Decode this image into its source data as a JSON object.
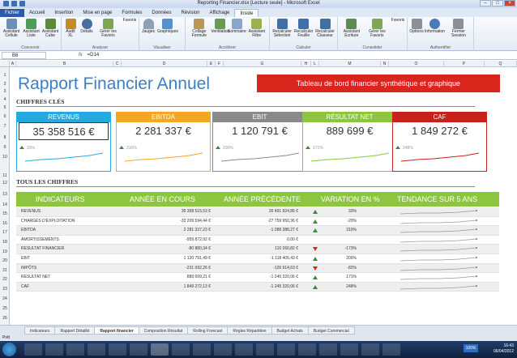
{
  "window": {
    "title": "Reporting Financier.xlsx [Lecture seule] - Microsoft Excel",
    "min": "–",
    "max": "□",
    "close": "×"
  },
  "ribbon": {
    "tabs": [
      "Fichier",
      "Accueil",
      "Insertion",
      "Mise en page",
      "Formules",
      "Données",
      "Révision",
      "Affichage",
      "Inside"
    ],
    "active_tab": "Inside",
    "groups": [
      {
        "label": "Concevoir",
        "buttons": [
          "Assistant Cellule",
          "Assistant Liste",
          "Assistant Cube"
        ]
      },
      {
        "label": "Analyser",
        "buttons": [
          "Audit XL",
          "Détails",
          "Gérer les Favoris",
          "Favoris"
        ]
      },
      {
        "label": "Visualiser",
        "buttons": [
          "Jauges",
          "Graphiques"
        ]
      },
      {
        "label": "Accélérer",
        "buttons": [
          "Collage Formule",
          "Ventilation",
          "Sommaire",
          "Assistant Filtre"
        ]
      },
      {
        "label": "Calculer",
        "buttons": [
          "Recalculer Sélection",
          "Recalculer Feuille",
          "Recalculer Classeur"
        ]
      },
      {
        "label": "Consolider",
        "buttons": [
          "Assistant Ecriture",
          "Gérer les Favoris",
          "Favoris"
        ]
      },
      {
        "label": "Authentifier",
        "buttons": [
          "Options",
          "Information",
          "Fermer Session"
        ]
      }
    ]
  },
  "formula_bar": {
    "name_box": "B6",
    "fx": "fx",
    "formula": "=D14"
  },
  "columns": [
    "A",
    "B",
    "C",
    "D",
    "E",
    "F",
    "G",
    "H",
    "L",
    "M",
    "N",
    "O",
    "P",
    "Q"
  ],
  "rows": [
    "1",
    "2",
    "3",
    "4",
    "5",
    "6",
    "7",
    "8",
    "9",
    "10",
    "11",
    "12",
    "13",
    "14",
    "15",
    "16",
    "17",
    "18",
    "19",
    "20",
    "21",
    "22",
    "23",
    "24",
    "25",
    "26"
  ],
  "sheet": {
    "title": "Rapport Financier Annuel",
    "banner": "Tableau de bord financier synthétique et graphique",
    "section_kpi": "CHIFFRES CLÉS",
    "section_table": "TOUS LES CHIFFRES",
    "kpis": [
      {
        "label": "REVENUS",
        "value": "35 358 516 €",
        "growth": "33%",
        "color": "#27a8e0"
      },
      {
        "label": "EBITDA",
        "value": "2 281 337 €",
        "growth": "310%",
        "color": "#f5a623"
      },
      {
        "label": "EBIT",
        "value": "1 120 791 €",
        "growth": "200%",
        "color": "#8a8a8a"
      },
      {
        "label": "RÉSULTAT NET",
        "value": "889 699 €",
        "growth": "171%",
        "color": "#8cc63f"
      },
      {
        "label": "CAF",
        "value": "1 849 272 €",
        "growth": "248%",
        "color": "#c8201a"
      }
    ],
    "table_headers": [
      "INDICATEURS",
      "ANNÉE EN COURS",
      "ANNÉE PRÉCÉDENTE",
      "VARIATION EN %",
      "TENDANCE SUR 5 ANS"
    ],
    "table_rows": [
      {
        "name": "REVENUS",
        "current": "35 358 515,53 €",
        "previous": "26 491 924,85 €",
        "dir": "up",
        "var": "33%"
      },
      {
        "name": "CHARGES D'EXPLOITATION",
        "current": "-33 209 594,44 €",
        "previous": "-27 759 950,36 €",
        "dir": "up",
        "var": "-20%"
      },
      {
        "name": "EBITDA",
        "current": "2 281 337,23 €",
        "previous": "-1 088 388,27 €",
        "dir": "up",
        "var": "310%"
      },
      {
        "name": "AMORTISSEMENTS",
        "current": "-959 872,92 €",
        "previous": "0,00 €",
        "dir": "",
        "var": ""
      },
      {
        "name": "RESULTAT FINANCIER",
        "current": "-80 880,34 €",
        "previous": "110 260,82 €",
        "dir": "down",
        "var": "-173%"
      },
      {
        "name": "EBIT",
        "current": "1 120 791,49 €",
        "previous": "-1 118 405,43 €",
        "dir": "up",
        "var": "200%"
      },
      {
        "name": "IMPÔTS",
        "current": "-231 092,26 €",
        "previous": "-126 914,63 €",
        "dir": "down",
        "var": "-82%"
      },
      {
        "name": "RESULTAT NET",
        "current": "889 699,21 €",
        "previous": "-1 245 320,06 €",
        "dir": "up",
        "var": "171%"
      },
      {
        "name": "CAF",
        "current": "1 849 272,13 €",
        "previous": "-1 245 320,06 €",
        "dir": "up",
        "var": "248%"
      }
    ]
  },
  "sheet_tabs": [
    "Indicateurs",
    "Rapport Détaillé",
    "Rapport financier",
    "Composition Résultat",
    "Rolling Forecast",
    "Règles Répartition",
    "Budget Achats",
    "Budget Commercial"
  ],
  "active_sheet": "Rapport financier",
  "status": {
    "ready": "Prêt",
    "zoom": "100%"
  },
  "taskbar": {
    "time": "16:43",
    "date": "06/04/2012"
  }
}
